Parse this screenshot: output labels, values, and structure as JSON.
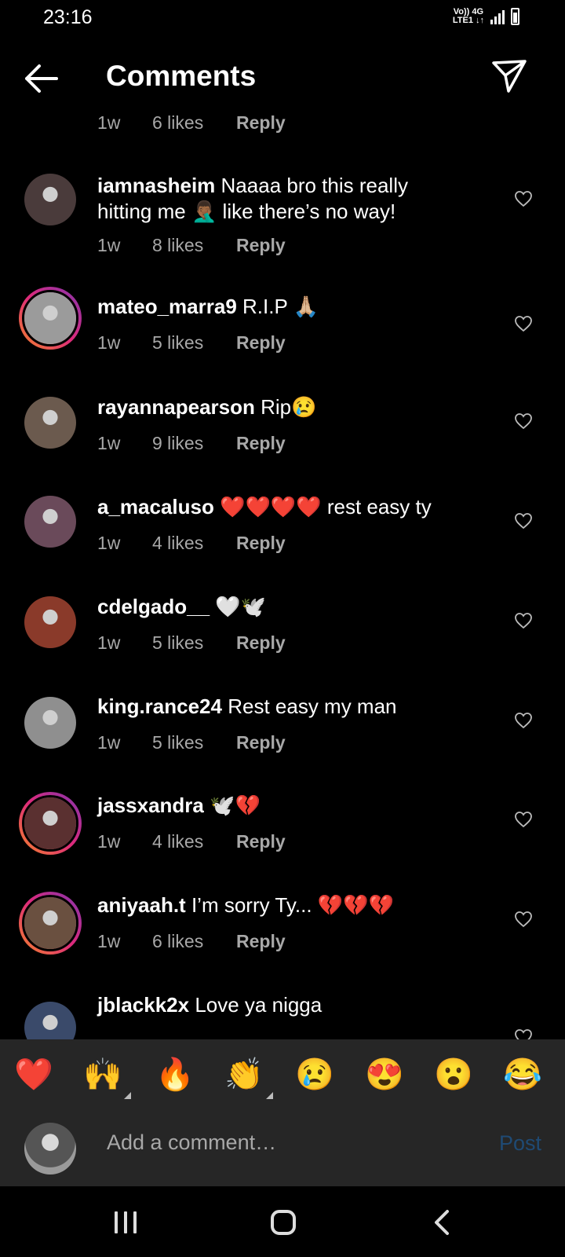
{
  "status_bar": {
    "time": "23:16",
    "network_top": "Vo)) 4G",
    "network_bottom": "LTE1 ↓↑"
  },
  "header": {
    "title": "Comments"
  },
  "partial_comment": {
    "time": "1w",
    "likes": "6 likes",
    "reply": "Reply"
  },
  "comments": [
    {
      "user": "iamnasheim",
      "text": "Naaaa bro this really hitting me 🤦🏾‍♂️ like there’s no way!",
      "time": "1w",
      "likes": "8 likes",
      "reply": "Reply",
      "avatar_color": "#4a3b3b",
      "story_ring": false
    },
    {
      "user": "mateo_marra9",
      "text": "R.I.P 🙏🏼",
      "time": "1w",
      "likes": "5 likes",
      "reply": "Reply",
      "avatar_color": "#9b9b9b",
      "story_ring": true
    },
    {
      "user": "rayannapearson",
      "text": "Rip😢",
      "time": "1w",
      "likes": "9 likes",
      "reply": "Reply",
      "avatar_color": "#6b5a4e",
      "story_ring": false
    },
    {
      "user": "a_macaluso",
      "text": "❤️❤️❤️❤️ rest easy ty",
      "time": "1w",
      "likes": "4 likes",
      "reply": "Reply",
      "avatar_color": "#6a4a5a",
      "story_ring": false
    },
    {
      "user": "cdelgado__",
      "text": "🤍🕊️",
      "time": "1w",
      "likes": "5 likes",
      "reply": "Reply",
      "avatar_color": "#8a3a2a",
      "story_ring": false
    },
    {
      "user": "king.rance24",
      "text": "Rest easy my man",
      "time": "1w",
      "likes": "5 likes",
      "reply": "Reply",
      "avatar_color": "#8f8f8f",
      "story_ring": false
    },
    {
      "user": "jassxandra",
      "text": "🕊️💔",
      "time": "1w",
      "likes": "4 likes",
      "reply": "Reply",
      "avatar_color": "#5a3030",
      "story_ring": true
    },
    {
      "user": "aniyaah.t",
      "text": "I’m sorry Ty... 💔💔💔",
      "time": "1w",
      "likes": "6 likes",
      "reply": "Reply",
      "avatar_color": "#6a5040",
      "story_ring": true
    },
    {
      "user": "jblackk2x",
      "text": "Love ya nigga",
      "time": "",
      "likes": "",
      "reply": "",
      "avatar_color": "#3a4a6a",
      "story_ring": false
    }
  ],
  "reactions": [
    "❤️",
    "🙌",
    "🔥",
    "👏",
    "😢",
    "😍",
    "😮",
    "😂"
  ],
  "composer": {
    "placeholder": "Add a comment…",
    "post_label": "Post"
  },
  "colors": {
    "background": "#000000",
    "panel": "#262626",
    "meta_text": "#a8a8a8",
    "post_disabled": "#1f4a74"
  }
}
